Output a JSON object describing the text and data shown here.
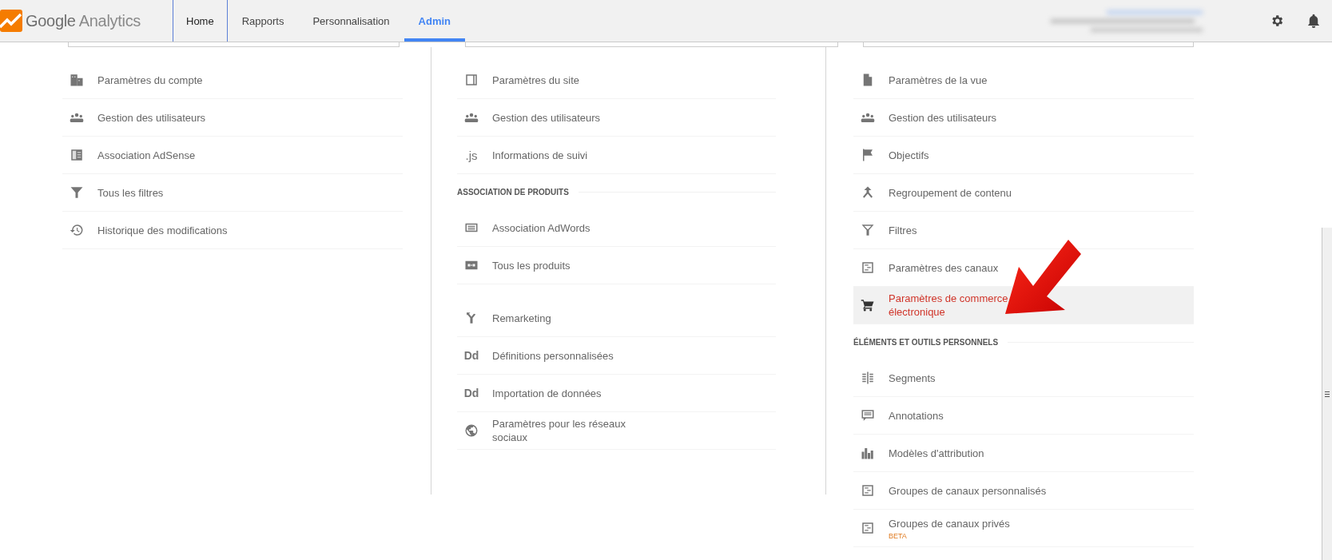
{
  "header": {
    "logo": {
      "brand": "Google",
      "product": "Analytics"
    },
    "tabs": [
      {
        "label": "Home",
        "selected": false,
        "boxed": true
      },
      {
        "label": "Rapports",
        "selected": false,
        "boxed": false
      },
      {
        "label": "Personnalisation",
        "selected": false,
        "boxed": false
      },
      {
        "label": "Admin",
        "selected": true,
        "boxed": false
      }
    ]
  },
  "columns": [
    {
      "sections": [
        {
          "items": [
            {
              "label": "Paramètres du compte",
              "selected": false
            },
            {
              "label": "Gestion des utilisateurs",
              "selected": false
            },
            {
              "label": "Association AdSense",
              "selected": false
            },
            {
              "label": "Tous les filtres",
              "selected": false
            },
            {
              "label": "Historique des modifications",
              "selected": false
            }
          ]
        }
      ]
    },
    {
      "sections": [
        {
          "items": [
            {
              "label": "Paramètres du site",
              "selected": false
            },
            {
              "label": "Gestion des utilisateurs",
              "selected": false
            },
            {
              "label": "Informations de suivi",
              "selected": false,
              "icon_text": ".js"
            }
          ]
        },
        {
          "heading": "ASSOCIATION DE PRODUITS",
          "items": [
            {
              "label": "Association AdWords",
              "selected": false
            },
            {
              "label": "Tous les produits",
              "selected": false
            }
          ]
        },
        {
          "items": [
            {
              "label": "Remarketing",
              "selected": false
            },
            {
              "label": "Définitions personnalisées",
              "selected": false,
              "icon_text": "Dd"
            },
            {
              "label": "Importation de données",
              "selected": false,
              "icon_text": "Dd"
            },
            {
              "label": "Paramètres pour les réseaux sociaux",
              "selected": false
            }
          ]
        }
      ]
    },
    {
      "sections": [
        {
          "items": [
            {
              "label": "Paramètres de la vue",
              "selected": false
            },
            {
              "label": "Gestion des utilisateurs",
              "selected": false
            },
            {
              "label": "Objectifs",
              "selected": false
            },
            {
              "label": "Regroupement de contenu",
              "selected": false
            },
            {
              "label": "Filtres",
              "selected": false
            },
            {
              "label": "Paramètres des canaux",
              "selected": false
            },
            {
              "label": "Paramètres de commerce électronique",
              "selected": true
            }
          ]
        },
        {
          "heading": "ÉLÉMENTS ET OUTILS PERSONNELS",
          "items": [
            {
              "label": "Segments",
              "selected": false
            },
            {
              "label": "Annotations",
              "selected": false
            },
            {
              "label": "Modèles d'attribution",
              "selected": false
            },
            {
              "label": "Groupes de canaux personnalisés",
              "selected": false
            },
            {
              "label": "Groupes de canaux privés",
              "selected": false,
              "badge": "BETA"
            }
          ]
        }
      ]
    }
  ]
}
